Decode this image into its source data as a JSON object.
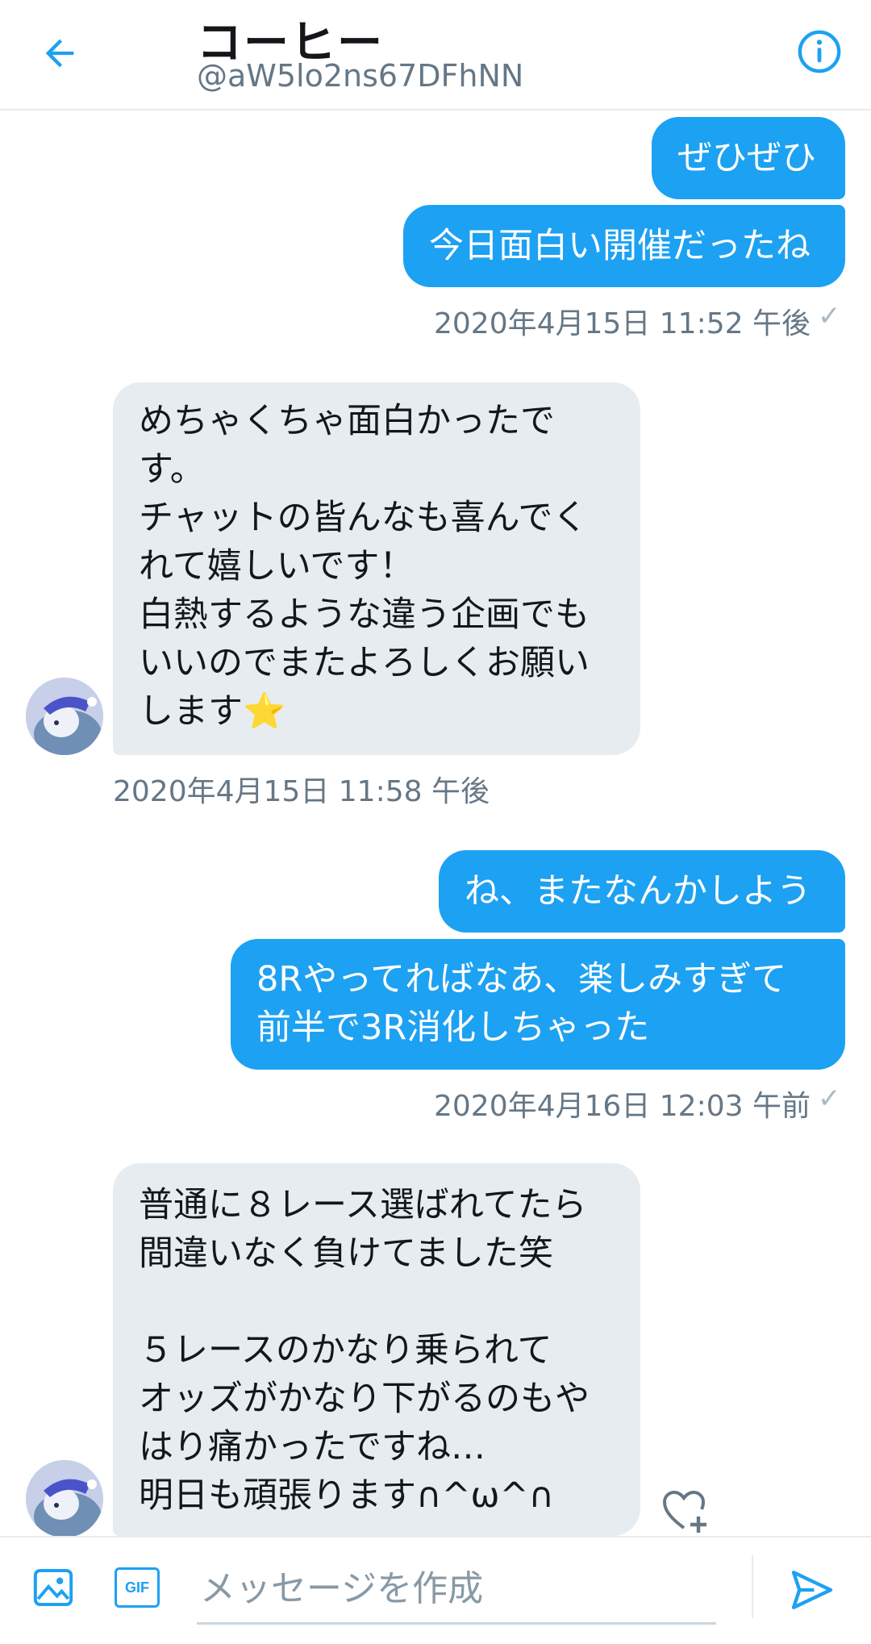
{
  "header": {
    "title": "コーヒー",
    "handle": "@aW5lo2ns67DFhNN"
  },
  "messages": [
    {
      "text": "ぜひぜひ"
    },
    {
      "text": "今日面白い開催だったね"
    },
    {
      "timestamp": "2020年4月15日 11:52 午後",
      "status": "✓"
    },
    {
      "text": "めちゃくちゃ面白かったで\nす。\nチャットの皆んなも喜んでく\nれて嬉しいです！\n白熱するような違う企画でも\nいいのでまたよろしくお願い\nします⭐"
    },
    {
      "timestamp": "2020年4月15日 11:58 午後"
    },
    {
      "text": "ね、またなんかしよう"
    },
    {
      "text": "8Rやってればなあ、楽しみすぎて\n前半で3R消化しちゃった"
    },
    {
      "timestamp": "2020年4月16日 12:03 午前",
      "status": "✓"
    },
    {
      "text": "普通に８レース選ばれてたら\n間違いなく負けてました笑\n\n５レースのかなり乗られて\nオッズがかなり下がるのもや\nはり痛かったですね…\n明日も頑張ります∩^ω^∩"
    }
  ],
  "composer": {
    "placeholder": "メッセージを作成",
    "gif_label": "GIF"
  },
  "colors": {
    "accent": "#1da1f2",
    "received_bubble": "#e6ecf0",
    "secondary_text": "#657786"
  }
}
